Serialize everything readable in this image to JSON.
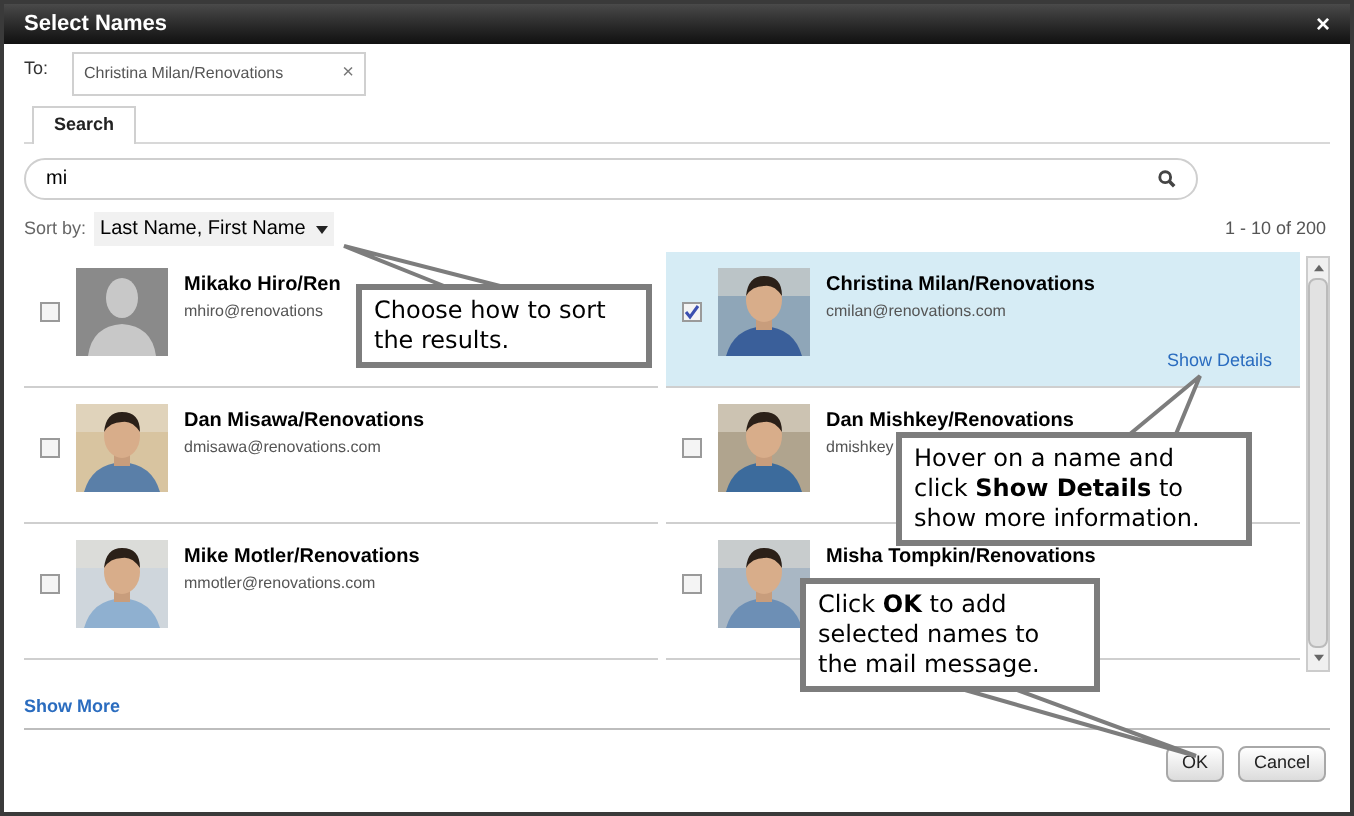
{
  "window": {
    "title": "Select Names",
    "close": "×"
  },
  "to": {
    "label": "To:",
    "recipient": "Christina Milan/Renovations",
    "remove": "×"
  },
  "tabs": [
    {
      "label": "Search",
      "selected": true
    }
  ],
  "search": {
    "value": "mi"
  },
  "sort": {
    "label": "Sort by:",
    "value": "Last Name, First Name"
  },
  "range": "1 - 10 of 200",
  "results": [
    {
      "name": "Mikako Hiro/Ren",
      "email": "mhiro@renovations",
      "checked": false,
      "selected": false,
      "kind": "placeholder"
    },
    {
      "name": "Christina Milan/Renovations",
      "email": "cmilan@renovations.com",
      "checked": true,
      "selected": true,
      "details_link": "Show Details"
    },
    {
      "name": "Dan Misawa/Renovations",
      "email": "dmisawa@renovations.com",
      "checked": false,
      "selected": false
    },
    {
      "name": "Dan Mishkey/Renovations",
      "email": "dmishkey",
      "checked": false,
      "selected": false
    },
    {
      "name": "Mike Motler/Renovations",
      "email": "mmotler@renovations.com",
      "checked": false,
      "selected": false
    },
    {
      "name": "Misha Tompkin/Renovations",
      "checked": false,
      "selected": false
    }
  ],
  "show_more": "Show More",
  "buttons": [
    "OK",
    "Cancel"
  ],
  "callouts": [
    "Choose how to sort the results.",
    "Hover on a name and click **Show Details** to show more information.",
    "Click **OK** to add selected names to the mail message."
  ]
}
